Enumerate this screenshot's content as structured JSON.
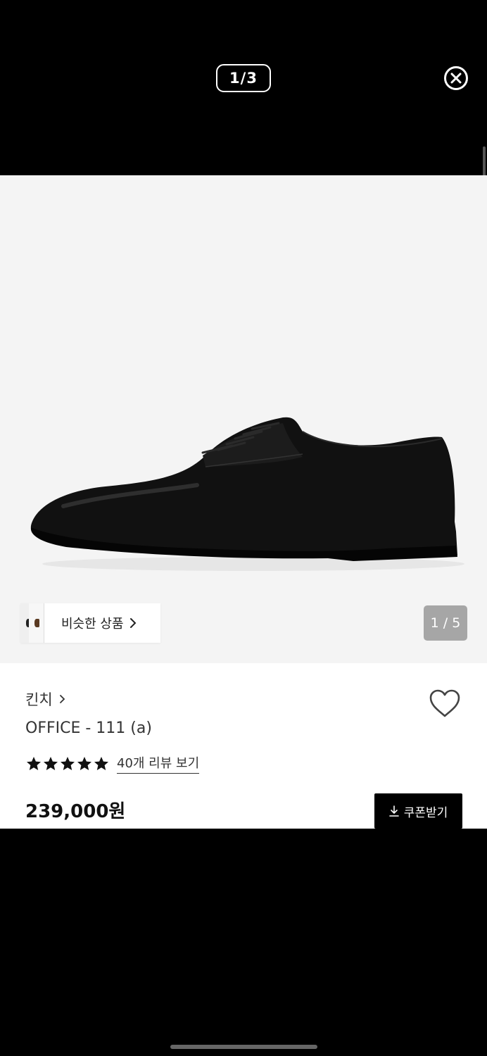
{
  "viewer": {
    "counter": "1/3",
    "close_icon": "close-circle-icon"
  },
  "product": {
    "image_counter": "1 / 5",
    "similar_label": "비슷한 상품",
    "brand": "킨치",
    "name": "OFFICE - 111 (a)",
    "rating_stars": 5,
    "review_link": "40개 리뷰 보기",
    "price": "239,000원",
    "coupon_button": "쿠폰받기"
  },
  "colors": {
    "background": "#000000",
    "image_bg": "#f4f4f4",
    "counter_badge": "#a6a6a6",
    "text": "#333333"
  }
}
